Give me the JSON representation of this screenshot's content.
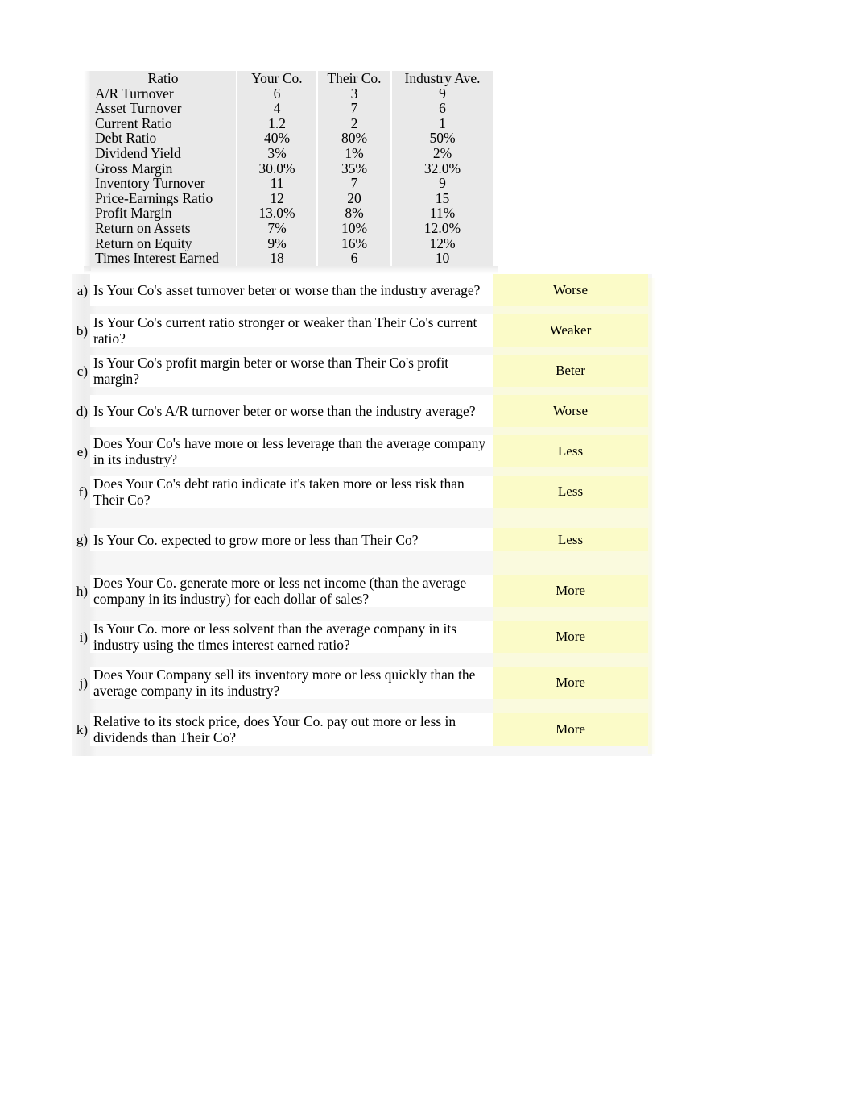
{
  "ratio_table": {
    "headers": [
      "Ratio",
      "Your Co.",
      "Their Co.",
      "Industry Ave."
    ],
    "rows": [
      {
        "name": "A/R Turnover",
        "your": "6",
        "their": "3",
        "industry": "9"
      },
      {
        "name": "Asset Turnover",
        "your": "4",
        "their": "7",
        "industry": "6"
      },
      {
        "name": "Current Ratio",
        "your": "1.2",
        "their": "2",
        "industry": "1"
      },
      {
        "name": "Debt Ratio",
        "your": "40%",
        "their": "80%",
        "industry": "50%"
      },
      {
        "name": "Dividend Yield",
        "your": "3%",
        "their": "1%",
        "industry": "2%"
      },
      {
        "name": "Gross Margin",
        "your": "30.0%",
        "their": "35%",
        "industry": "32.0%"
      },
      {
        "name": "Inventory Turnover",
        "your": "11",
        "their": "7",
        "industry": "9"
      },
      {
        "name": "Price-Earnings Ratio",
        "your": "12",
        "their": "20",
        "industry": "15"
      },
      {
        "name": "Profit Margin",
        "your": "13.0%",
        "their": "8%",
        "industry": "11%"
      },
      {
        "name": "Return on Assets",
        "your": "7%",
        "their": "10%",
        "industry": "12.0%"
      },
      {
        "name": "Return on Equity",
        "your": "9%",
        "their": "16%",
        "industry": "12%"
      },
      {
        "name": "Times Interest Earned",
        "your": "18",
        "their": "6",
        "industry": "10"
      }
    ]
  },
  "questions": [
    {
      "letter": "a)",
      "text": "Is Your Co's asset turnover beter or worse than the industry average?",
      "answer": "Worse"
    },
    {
      "letter": "b)",
      "text": "Is Your Co's current ratio stronger or weaker than Their Co's current ratio?",
      "answer": "Weaker"
    },
    {
      "letter": "c)",
      "text": "Is Your Co's profit margin beter or worse than Their Co's profit margin?",
      "answer": "Beter"
    },
    {
      "letter": "d)",
      "text": "Is Your Co's A/R turnover beter or worse than the industry average?",
      "answer": "Worse"
    },
    {
      "letter": "e)",
      "text": "Does Your Co's have more or less leverage than the average company in its industry?",
      "answer": "Less"
    },
    {
      "letter": "f)",
      "text": "Does Your Co's debt ratio indicate it's taken more or less risk than Their Co?",
      "answer": "Less"
    },
    {
      "letter": "g)",
      "text": "Is Your Co. expected to grow more or less than Their Co?",
      "answer": "Less"
    },
    {
      "letter": "h)",
      "text": "Does Your Co. generate more or less net income (than the average company in its industry) for each dollar of sales?",
      "answer": "More"
    },
    {
      "letter": "i)",
      "text": "Is Your Co. more or less solvent than the average company in its industry using the times interest earned ratio?",
      "answer": "More"
    },
    {
      "letter": "j)",
      "text": "Does Your Company sell its inventory more or less quickly than the average company in its industry?",
      "answer": "More"
    },
    {
      "letter": "k)",
      "text": "Relative to its stock price, does Your Co. pay out more or less in dividends than Their Co?",
      "answer": "More"
    }
  ],
  "colors": {
    "table_bg": "#e9e9e9",
    "answer_bg": "#fbfbc8",
    "answer_band": "#fafade",
    "question_bg": "#ffffff",
    "page_bg": "#ffffff",
    "text": "#000000"
  }
}
